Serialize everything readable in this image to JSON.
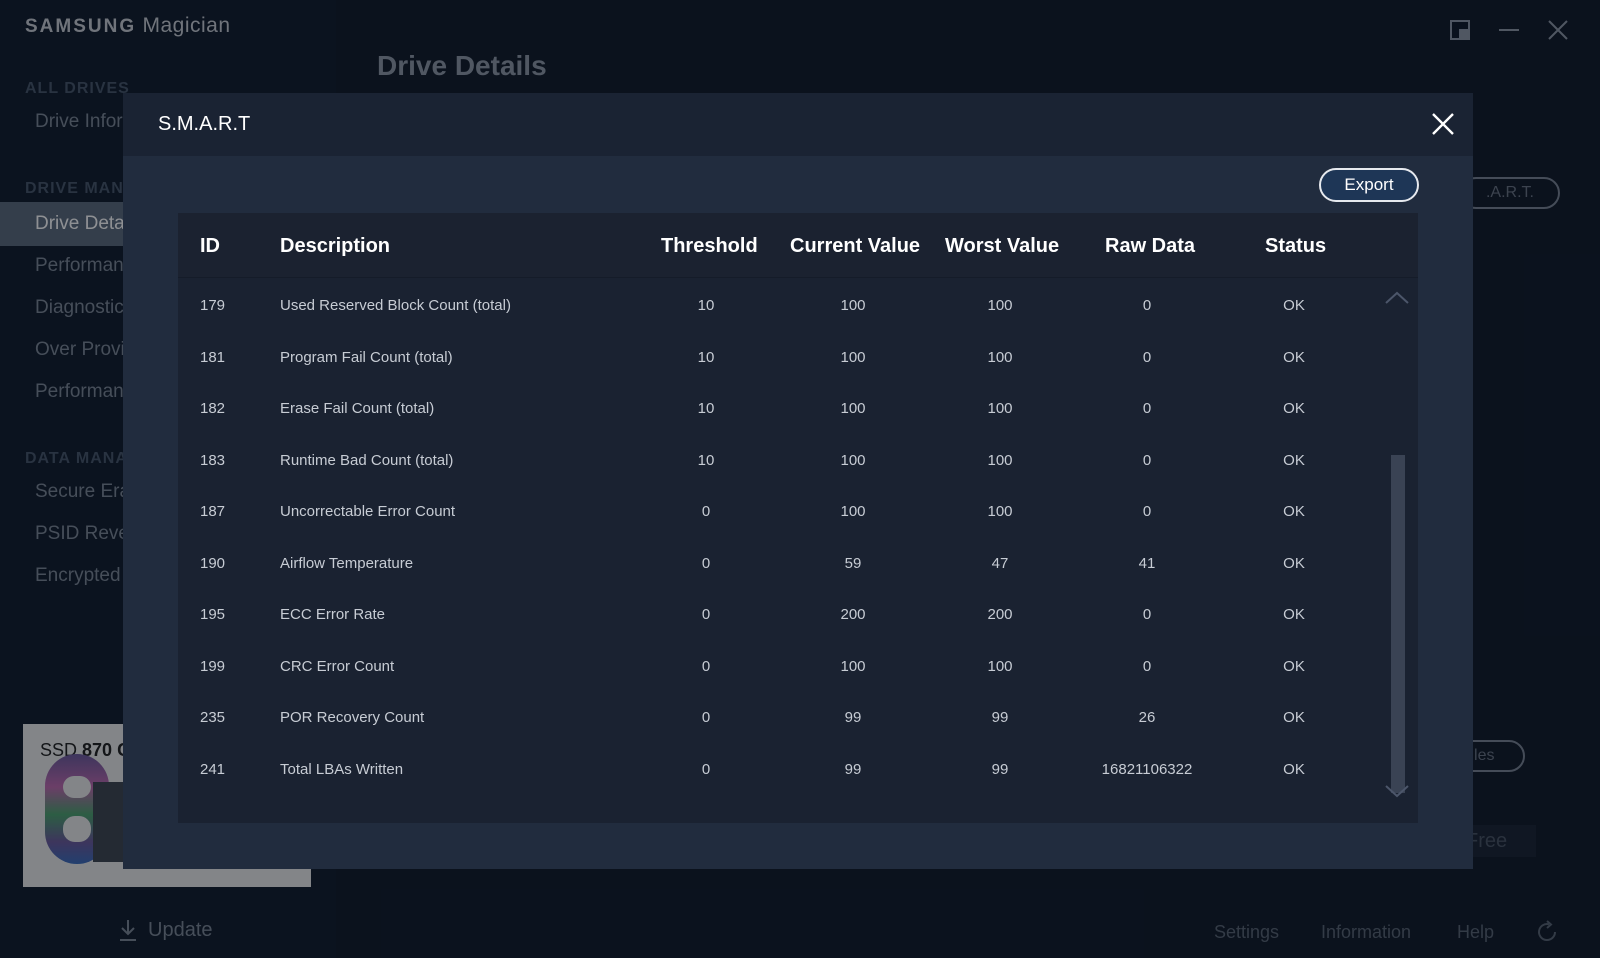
{
  "app": {
    "logo_brand": "SAMSUNG",
    "logo_product": "Magician",
    "page_title": "Drive Details"
  },
  "sidebar": {
    "sections": [
      "ALL DRIVES",
      "DRIVE MAN",
      "DATA MANA"
    ],
    "items": [
      {
        "label": "Drive Infor"
      },
      {
        "label": "Drive Deta"
      },
      {
        "label": "Performan"
      },
      {
        "label": "Diagnostic"
      },
      {
        "label": "Over Provi"
      },
      {
        "label": "Performan"
      },
      {
        "label": "Secure Era"
      },
      {
        "label": "PSID Reve"
      },
      {
        "label": "Encrypted"
      }
    ],
    "drive_card": {
      "name_prefix": "SSD",
      "name_model": "870 C"
    },
    "update_label": "Update"
  },
  "background": {
    "smart_button_fragment": ".A.R.T.",
    "files_button_fragment": "iles",
    "free_fragment": "Free"
  },
  "footer": {
    "settings": "Settings",
    "information": "Information",
    "help": "Help"
  },
  "dialog": {
    "title": "S.M.A.R.T",
    "export_label": "Export",
    "columns": [
      "ID",
      "Description",
      "Threshold",
      "Current Value",
      "Worst Value",
      "Raw Data",
      "Status"
    ],
    "rows": [
      {
        "id": "179",
        "description": "Used Reserved Block Count (total)",
        "threshold": "10",
        "current": "100",
        "worst": "100",
        "raw": "0",
        "status": "OK"
      },
      {
        "id": "181",
        "description": "Program Fail Count (total)",
        "threshold": "10",
        "current": "100",
        "worst": "100",
        "raw": "0",
        "status": "OK"
      },
      {
        "id": "182",
        "description": "Erase Fail Count (total)",
        "threshold": "10",
        "current": "100",
        "worst": "100",
        "raw": "0",
        "status": "OK"
      },
      {
        "id": "183",
        "description": "Runtime Bad Count (total)",
        "threshold": "10",
        "current": "100",
        "worst": "100",
        "raw": "0",
        "status": "OK"
      },
      {
        "id": "187",
        "description": "Uncorrectable Error Count",
        "threshold": "0",
        "current": "100",
        "worst": "100",
        "raw": "0",
        "status": "OK"
      },
      {
        "id": "190",
        "description": "Airflow Temperature",
        "threshold": "0",
        "current": "59",
        "worst": "47",
        "raw": "41",
        "status": "OK"
      },
      {
        "id": "195",
        "description": "ECC Error Rate",
        "threshold": "0",
        "current": "200",
        "worst": "200",
        "raw": "0",
        "status": "OK"
      },
      {
        "id": "199",
        "description": "CRC Error Count",
        "threshold": "0",
        "current": "100",
        "worst": "100",
        "raw": "0",
        "status": "OK"
      },
      {
        "id": "235",
        "description": "POR Recovery Count",
        "threshold": "0",
        "current": "99",
        "worst": "99",
        "raw": "26",
        "status": "OK"
      },
      {
        "id": "241",
        "description": "Total LBAs Written",
        "threshold": "0",
        "current": "99",
        "worst": "99",
        "raw": "16821106322",
        "status": "OK"
      }
    ]
  },
  "colors": {
    "dialog_bg": "#212c3e",
    "table_bg": "#1a2231",
    "sidebar_active": "#5c6a7d",
    "export_bg": "#1e3656"
  },
  "icons": [
    "close-icon",
    "scroll-up-chevron-icon",
    "scroll-down-chevron-icon",
    "download-icon",
    "restore-window-icon",
    "minimize-icon",
    "refresh-icon"
  ]
}
